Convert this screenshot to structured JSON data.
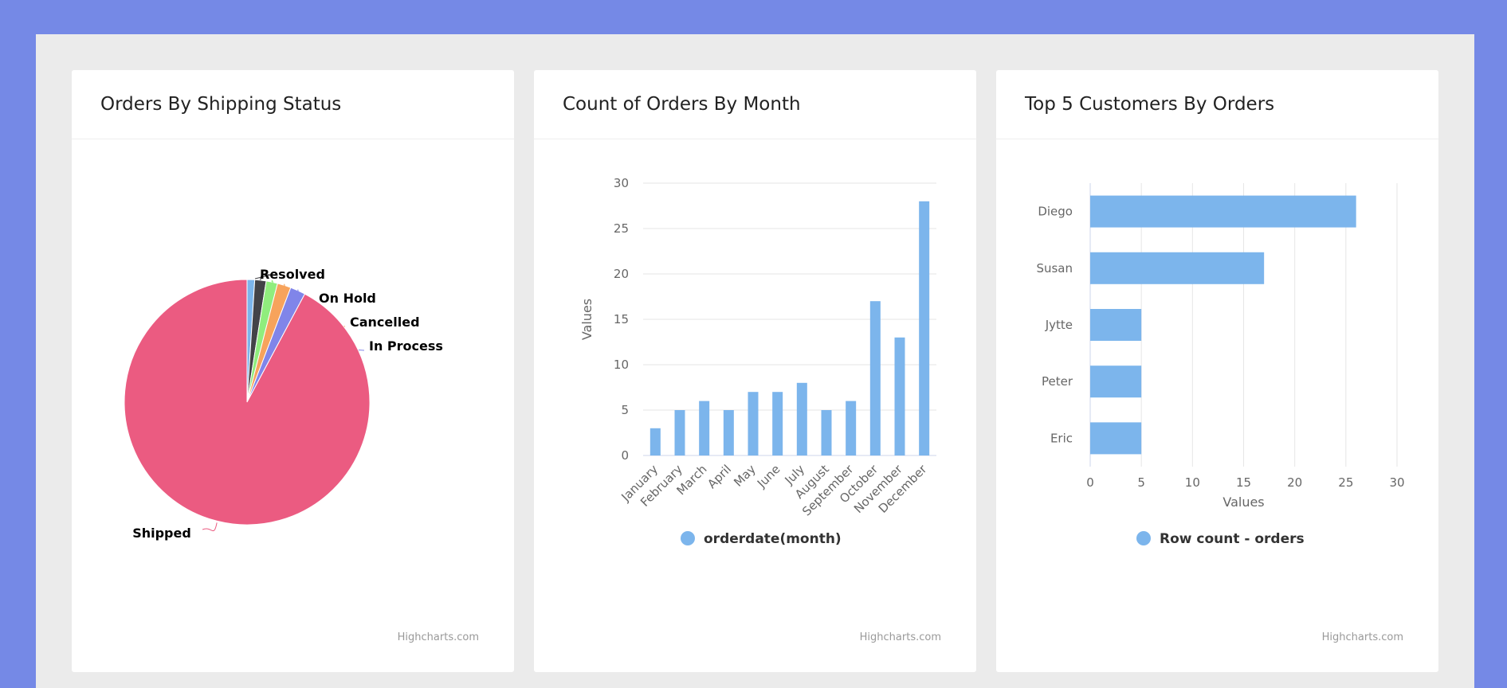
{
  "charts": {
    "pie": {
      "title": "Orders By Shipping Status",
      "credit": "Highcharts.com"
    },
    "month": {
      "title": "Count of Orders By Month",
      "credit": "Highcharts.com",
      "legend_label": "orderdate(month)"
    },
    "customers": {
      "title": "Top 5 Customers By Orders",
      "credit": "Highcharts.com",
      "legend_label": "Row count - orders"
    }
  },
  "chart_data": [
    {
      "type": "pie",
      "title": "Orders By Shipping Status",
      "slices": [
        {
          "label": "",
          "value": 1,
          "color": "#7cb5ec"
        },
        {
          "label": "Resolved",
          "value": 1.5,
          "color": "#434348"
        },
        {
          "label": "On Hold",
          "value": 1.5,
          "color": "#90ed7d"
        },
        {
          "label": "Cancelled",
          "value": 1.8,
          "color": "#f7a35c"
        },
        {
          "label": "In Process",
          "value": 2,
          "color": "#8085e9"
        },
        {
          "label": "Shipped",
          "value": 92.2,
          "color": "#eb5b81"
        }
      ]
    },
    {
      "type": "bar",
      "title": "Count of Orders By Month",
      "categories": [
        "January",
        "February",
        "March",
        "April",
        "May",
        "June",
        "July",
        "August",
        "September",
        "October",
        "November",
        "December"
      ],
      "values": [
        3,
        5,
        6,
        5,
        7,
        7,
        8,
        5,
        6,
        17,
        13,
        28
      ],
      "series": [
        {
          "name": "orderdate(month)",
          "values": [
            3,
            5,
            6,
            5,
            7,
            7,
            8,
            5,
            6,
            17,
            13,
            28
          ]
        }
      ],
      "ylabel": "Values",
      "ylim": [
        0,
        30
      ],
      "yticks": [
        0,
        5,
        10,
        15,
        20,
        25,
        30
      ],
      "color": "#7cb5ec",
      "grid": true,
      "legend": "bottom"
    },
    {
      "type": "bar",
      "orientation": "horizontal",
      "title": "Top 5 Customers By Orders",
      "categories": [
        "Diego",
        "Susan",
        "Jytte",
        "Peter",
        "Eric"
      ],
      "values": [
        26,
        17,
        5,
        5,
        5
      ],
      "series": [
        {
          "name": "Row count - orders",
          "values": [
            26,
            17,
            5,
            5,
            5
          ]
        }
      ],
      "xlabel": "Values",
      "xlim": [
        0,
        30
      ],
      "xticks": [
        0,
        5,
        10,
        15,
        20,
        25,
        30
      ],
      "color": "#7cb5ec",
      "grid": true,
      "legend": "bottom"
    }
  ]
}
